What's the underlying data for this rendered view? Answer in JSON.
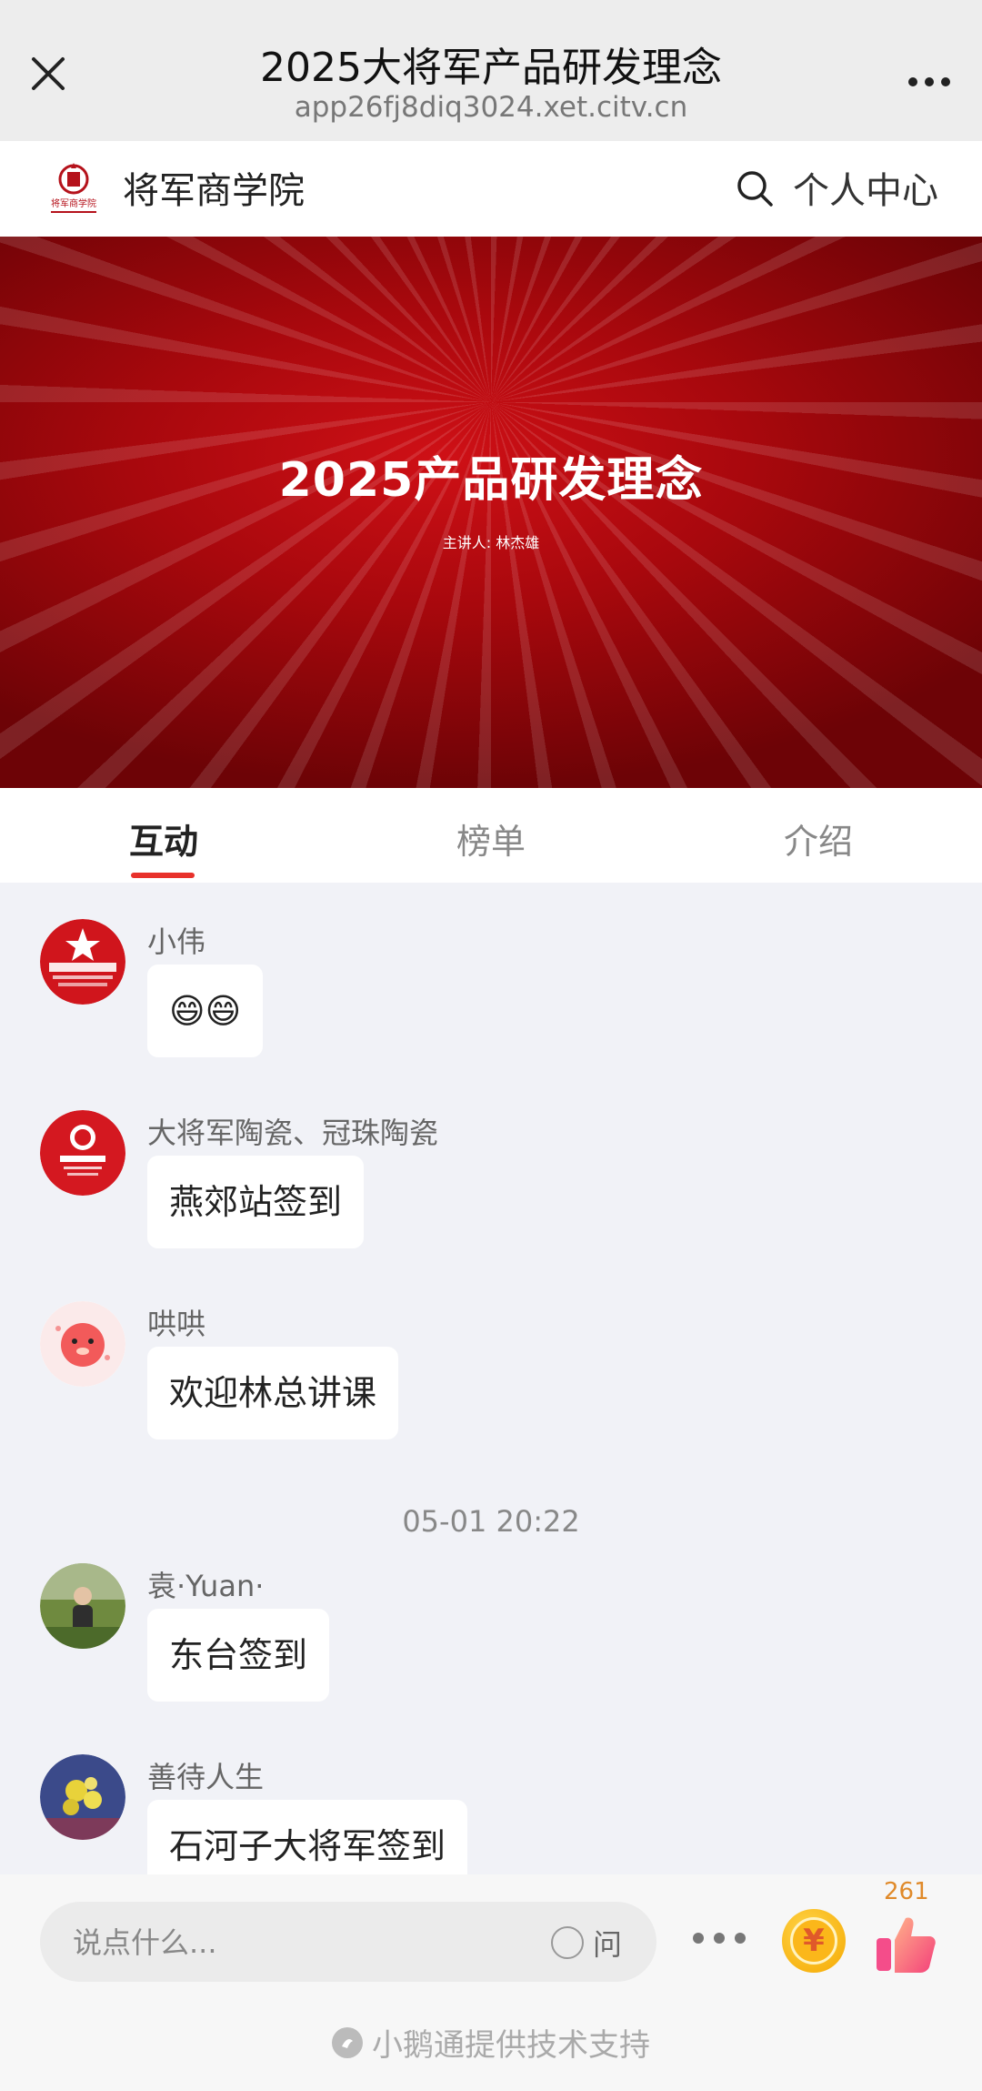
{
  "browser": {
    "title": "2025大将军产品研发理念",
    "url": "app26fj8diq3024.xet.citv.cn"
  },
  "header": {
    "logo_text": "将军商学院",
    "site_name": "将军商学院",
    "user_center": "个人中心"
  },
  "banner": {
    "title": "2025产品研发理念",
    "subtitle": "主讲人: 林杰雄"
  },
  "tabs": [
    {
      "label": "互动",
      "active": true
    },
    {
      "label": "榜单",
      "active": false
    },
    {
      "label": "介绍",
      "active": false
    }
  ],
  "messages": [
    {
      "nick": "小伟",
      "text": "😄😄",
      "avatar": "star-logo-avatar"
    },
    {
      "nick": "大将军陶瓷、冠珠陶瓷",
      "text": "燕郊站签到",
      "avatar": "red-logo-avatar"
    },
    {
      "nick": "哄哄",
      "text": "欢迎林总讲课",
      "avatar": "pink-character-avatar"
    },
    {
      "nick": "袁·Yuan·",
      "text": "东台签到",
      "avatar": "outdoor-photo-avatar"
    },
    {
      "nick": "善待人生",
      "text": "石河子大将军签到",
      "avatar": "flower-photo-avatar"
    }
  ],
  "time_stamp": "05-01 20:22",
  "bottom": {
    "placeholder": "说点什么...",
    "ask_label": "问",
    "reward_symbol": "¥",
    "like_count": "261",
    "powered_by": "小鹅通提供技术支持"
  },
  "colors": {
    "accent": "#e8312b",
    "banner": "#b30a10"
  }
}
